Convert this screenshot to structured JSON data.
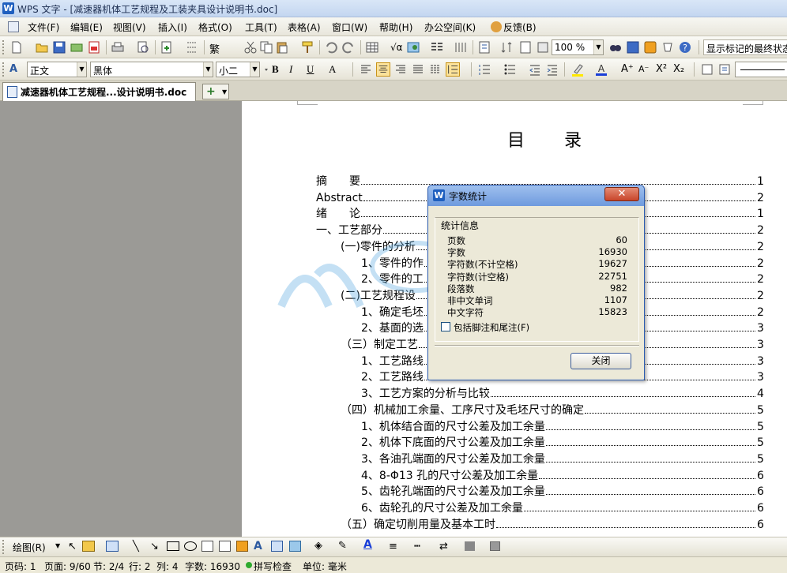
{
  "window": {
    "title": "WPS 文字 - [减速器机体工艺规程及工装夹具设计说明书.doc]"
  },
  "menu": [
    "文件(F)",
    "编辑(E)",
    "视图(V)",
    "插入(I)",
    "格式(O)",
    "工具(T)",
    "表格(A)",
    "窗口(W)",
    "帮助(H)",
    "办公空间(K)",
    "反馈(B)"
  ],
  "toolbar1": {
    "zoom": "100 %",
    "markup_label": "显示标记的最终状态"
  },
  "toolbar2": {
    "style": "正文",
    "font": "黑体",
    "size": "小二"
  },
  "tabs": {
    "doc_tab": "减速器机体工艺规程...设计说明书.doc",
    "new_tab": "+"
  },
  "document": {
    "heading": "目　　录",
    "toc": [
      {
        "text": "摘　　要",
        "page": "1",
        "indent": 0
      },
      {
        "text": "Abstract",
        "page": "2",
        "indent": 0
      },
      {
        "text": "绪　　论",
        "page": "1",
        "indent": 0
      },
      {
        "text": "一、工艺部分",
        "page": "2",
        "indent": 0
      },
      {
        "text": "(一)零件的分析",
        "page": "2",
        "indent": 1
      },
      {
        "text": "1、零件的作",
        "page": "2",
        "indent": 2
      },
      {
        "text": "2、零件的工",
        "page": "2",
        "indent": 2
      },
      {
        "text": "(二)工艺规程设",
        "page": "2",
        "indent": 1
      },
      {
        "text": "1、确定毛坯",
        "page": "2",
        "indent": 2
      },
      {
        "text": "2、基面的选",
        "page": "3",
        "indent": 2
      },
      {
        "text": "（三）制定工艺",
        "page": "3",
        "indent": 1
      },
      {
        "text": "1、工艺路线",
        "page": "3",
        "indent": 2
      },
      {
        "text": "2、工艺路线",
        "page": "3",
        "indent": 2
      },
      {
        "text": "3、工艺方案的分析与比较",
        "page": "4",
        "indent": 2
      },
      {
        "text": "（四）机械加工余量、工序尺寸及毛坯尺寸的确定",
        "page": "5",
        "indent": 1
      },
      {
        "text": "1、机体结合面的尺寸公差及加工余量",
        "page": "5",
        "indent": 2
      },
      {
        "text": "2、机体下底面的尺寸公差及加工余量",
        "page": "5",
        "indent": 2
      },
      {
        "text": "3、各油孔端面的尺寸公差及加工余量",
        "page": "5",
        "indent": 2
      },
      {
        "text": "4、8-Φ13 孔的尺寸公差及加工余量",
        "page": "6",
        "indent": 2
      },
      {
        "text": "5、齿轮孔端面的尺寸公差及加工余量",
        "page": "6",
        "indent": 2
      },
      {
        "text": "6、齿轮孔的尺寸公差及加工余量",
        "page": "6",
        "indent": 2
      },
      {
        "text": "（五）确定切削用量及基本工时",
        "page": "6",
        "indent": 1
      }
    ]
  },
  "dialog": {
    "title": "字数统计",
    "close_x": "✕",
    "group_label": "统计信息",
    "stats": [
      {
        "label": "页数",
        "value": "60"
      },
      {
        "label": "字数",
        "value": "16930"
      },
      {
        "label": "字符数(不计空格)",
        "value": "19627"
      },
      {
        "label": "字符数(计空格)",
        "value": "22751"
      },
      {
        "label": "段落数",
        "value": "982"
      },
      {
        "label": "非中文单词",
        "value": "1107"
      },
      {
        "label": "中文字符",
        "value": "15823"
      }
    ],
    "checkbox_label": "包括脚注和尾注(F)",
    "close_button": "关闭"
  },
  "drawbar": {
    "draw_menu": "绘图(R)"
  },
  "status": {
    "page_code": "页码: 1",
    "page": "页面: 9/60",
    "section": "节: 2/4",
    "row": "行: 2",
    "col": "列: 4",
    "words": "字数: 16930",
    "spell": "拼写检查",
    "unit": "单位: 毫米"
  }
}
